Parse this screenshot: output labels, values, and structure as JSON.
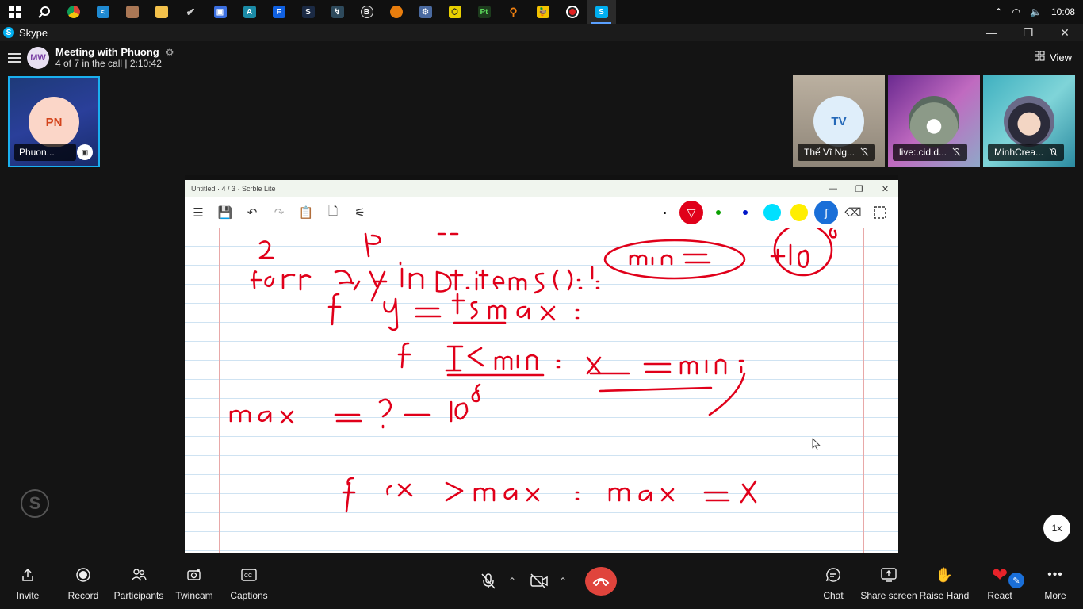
{
  "taskbar": {
    "icons": [
      "windows-start-icon",
      "search-icon",
      "chrome-icon",
      "vscode-icon",
      "cube-icon",
      "file-explorer-icon",
      "check-icon",
      "app-icon",
      "android-icon",
      "app-f-icon",
      "steam-icon",
      "terminal-icon",
      "b-icon",
      "blender-icon",
      "gear-icon",
      "nodejs-icon",
      "pt-icon",
      "magnifier-icon",
      "duck-icon",
      "record-icon",
      "skype-icon"
    ],
    "time": "10:08"
  },
  "window": {
    "title": "Skype"
  },
  "meeting": {
    "avatar_initials": "MW",
    "title": "Meeting with Phuong",
    "subtitle": "4 of 7 in the call | 2:10:42",
    "view_label": "View"
  },
  "participants": {
    "self": {
      "initials": "PN",
      "name": "Phuon..."
    },
    "others": [
      {
        "initials": "TV",
        "name": "Thế Vĩ Ng..."
      },
      {
        "name": "live:.cid.d..."
      },
      {
        "name": "MinhCrea..."
      }
    ]
  },
  "shared_window": {
    "title": "Untitled · 4 / 3 · Scrble Lite",
    "pen_colors": [
      "#000000",
      "#e0001a",
      "#0aa000",
      "#0016c8",
      "#00e0ff",
      "#ffee00",
      "#1a6fd8"
    ]
  },
  "speed_label": "1x",
  "controls": {
    "invite": "Invite",
    "record": "Record",
    "participants": "Participants",
    "twincam": "Twincam",
    "captions": "Captions",
    "chat": "Chat",
    "share_screen": "Share screen",
    "raise_hand": "Raise Hand",
    "react": "React",
    "more": "More"
  }
}
